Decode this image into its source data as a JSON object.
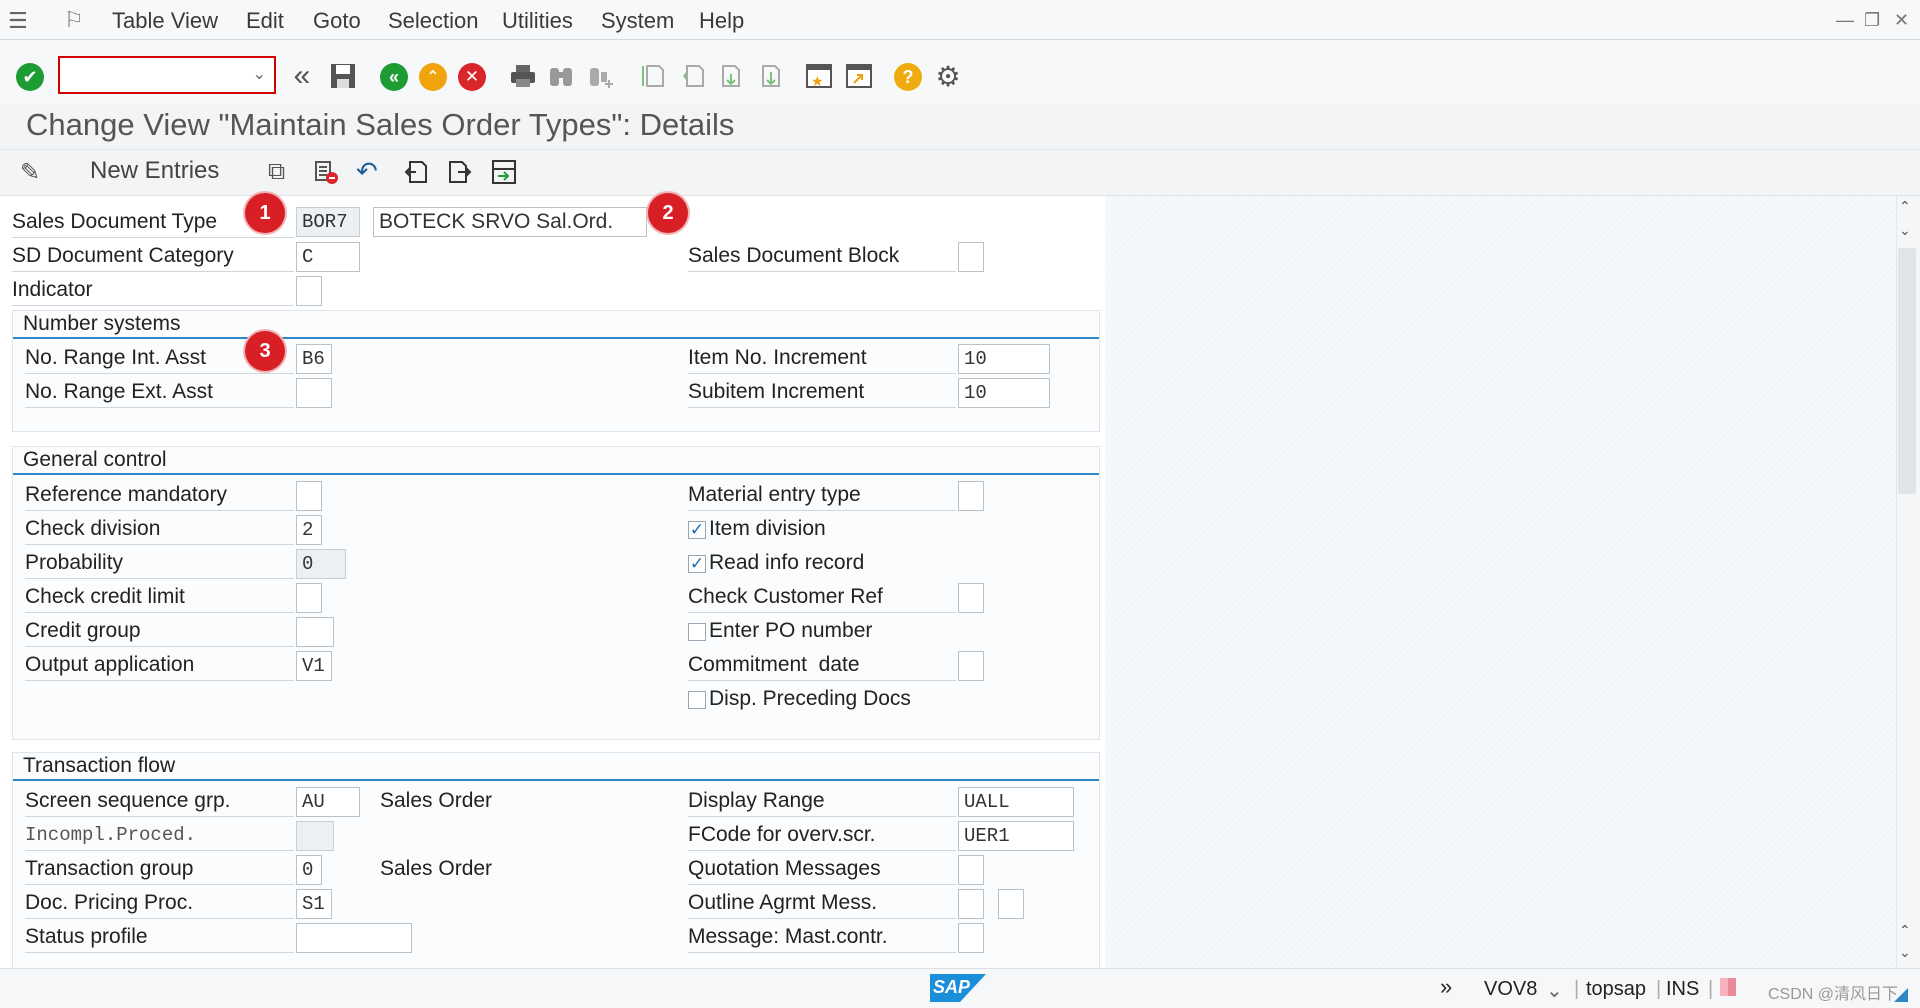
{
  "menu": {
    "items": [
      "Table View",
      "Edit",
      "Goto",
      "Selection",
      "Utilities",
      "System",
      "Help"
    ]
  },
  "toolbar": {
    "command_field_value": "",
    "icons": [
      "enter-icon",
      "command-field",
      "back-arrows-icon",
      "save-icon",
      "back-icon",
      "exit-icon",
      "cancel-icon",
      "print-icon",
      "find-icon",
      "find-next-icon",
      "first-page-icon",
      "previous-page-icon",
      "next-page-icon",
      "last-page-icon",
      "create-session-icon",
      "shortcut-icon",
      "help-icon",
      "customize-layout-icon"
    ]
  },
  "title": "Change View \"Maintain Sales Order Types\": Details",
  "app_toolbar": {
    "new_entries_label": "New Entries"
  },
  "header_fields": {
    "sales_doc_type_label": "Sales Document Type",
    "sales_doc_type_value": "BOR7",
    "sales_doc_type_desc": "BOTECK SRVO Sal.Ord.",
    "sd_doc_category_label": "SD Document Category",
    "sd_doc_category_value": "C",
    "sales_doc_block_label": "Sales Document Block",
    "sales_doc_block_value": "",
    "indicator_label": "Indicator",
    "indicator_value": ""
  },
  "badges": [
    "1",
    "2",
    "3"
  ],
  "number_systems": {
    "title": "Number systems",
    "no_range_int_label": "No. Range Int. Asst",
    "no_range_int_value": "B6",
    "no_range_ext_label": "No. Range Ext. Asst",
    "no_range_ext_value": "",
    "item_no_increment_label": "Item No. Increment",
    "item_no_increment_value": "10",
    "subitem_increment_label": "Subitem Increment",
    "subitem_increment_value": "10"
  },
  "general_control": {
    "title": "General control",
    "reference_mandatory_label": "Reference mandatory",
    "reference_mandatory_value": "",
    "check_division_label": "Check division",
    "check_division_value": "2",
    "probability_label": "Probability",
    "probability_value": "0",
    "check_credit_limit_label": "Check credit limit",
    "check_credit_limit_value": "",
    "credit_group_label": "Credit group",
    "credit_group_value": "",
    "output_application_label": "Output application",
    "output_application_value": "V1",
    "material_entry_type_label": "Material entry type",
    "material_entry_type_value": "",
    "item_division_label": "Item division",
    "item_division_checked": true,
    "read_info_record_label": "Read info record",
    "read_info_record_checked": true,
    "check_customer_ref_label": "Check Customer Ref",
    "check_customer_ref_value": "",
    "enter_po_number_label": "Enter PO number",
    "enter_po_number_checked": false,
    "commitment_date_label": "Commitment  date",
    "commitment_date_value": "",
    "disp_preceding_docs_label": "Disp. Preceding Docs",
    "disp_preceding_docs_checked": false
  },
  "transaction_flow": {
    "title": "Transaction flow",
    "screen_seq_grp_label": "Screen sequence grp.",
    "screen_seq_grp_value": "AU",
    "screen_seq_grp_desc": "Sales Order",
    "incompl_proced_label": "Incompl.Proced.",
    "incompl_proced_value": "",
    "transaction_group_label": "Transaction group",
    "transaction_group_value": "0",
    "transaction_group_desc": "Sales Order",
    "doc_pricing_proc_label": "Doc. Pricing Proc.",
    "doc_pricing_proc_value": "S1",
    "status_profile_label": "Status profile",
    "status_profile_value": "",
    "display_range_label": "Display Range",
    "display_range_value": "UALL",
    "fcode_overv_label": "FCode for overv.scr.",
    "fcode_overv_value": "UER1",
    "quotation_messages_label": "Quotation Messages",
    "quotation_messages_value": "",
    "outline_agrmt_label": "Outline Agrmt Mess.",
    "outline_agrmt_value": "",
    "message_mast_label": "Message: Mast.contr.",
    "message_mast_value": ""
  },
  "status_bar": {
    "transaction": "VOV8",
    "server": "topsap",
    "mode": "INS",
    "logo": "SAP",
    "watermark": "CSDN @清风日下"
  },
  "colors": {
    "accent_blue": "#2f86c4",
    "badge_red": "#d81f26",
    "enter_green": "#1d9c34",
    "cancel_red": "#d9262b",
    "exit_orange": "#f0a30a",
    "help_yellow": "#f0ac0e"
  }
}
